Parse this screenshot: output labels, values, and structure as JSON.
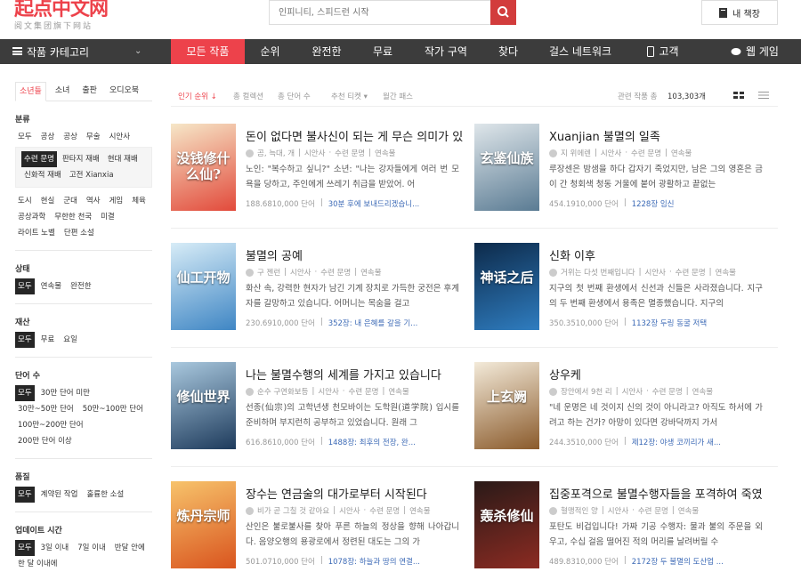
{
  "header": {
    "logo_main": "起点中文网",
    "logo_sub": "阅文集团旗下网站",
    "search_placeholder": "인피니티, 스피드런 시작",
    "shelf_label": "내 책장"
  },
  "nav": {
    "category_label": "작품 카테고리",
    "items": [
      {
        "label": "모든 작품",
        "active": true
      },
      {
        "label": "순위"
      },
      {
        "label": "완전한"
      },
      {
        "label": "무료"
      },
      {
        "label": "작가 구역"
      },
      {
        "label": "찾다"
      },
      {
        "label": "걸스 네트워크"
      },
      {
        "label": "고객"
      },
      {
        "label": "웹 게임"
      }
    ]
  },
  "sidebar": {
    "tabs": [
      "소년들",
      "소녀",
      "출판",
      "오디오북"
    ],
    "sections": {
      "genre_title": "분류",
      "genre_row1": [
        "모두",
        "공상",
        "공상",
        "무술",
        "시안사"
      ],
      "genre_sub": [
        "수련 문명",
        "판타지 재배",
        "현대 재배",
        "신화적 재배",
        "고전 Xianxia"
      ],
      "genre_more": [
        "도시",
        "현실",
        "군대",
        "역사",
        "게임",
        "체육",
        "공상과학",
        "무한한 천국",
        "미결",
        "라이트 노벨",
        "단편 소설"
      ],
      "status_title": "상태",
      "status": [
        "모두",
        "연속물",
        "완전한"
      ],
      "property_title": "재산",
      "property": [
        "모두",
        "무료",
        "요일"
      ],
      "words_title": "단어 수",
      "words": [
        "모두",
        "30만 단어 미만",
        "30만~50만 단어",
        "50만~100만 단어",
        "100만~200만 단어",
        "200만 단어 이상"
      ],
      "quality_title": "품질",
      "quality": [
        "모두",
        "계약된 작업",
        "훌륭한 소설"
      ],
      "update_title": "업데이트 시간",
      "update": [
        "모두",
        "3일 이내",
        "7일 이내",
        "반달 안에",
        "한 달 이내에"
      ]
    }
  },
  "filter": {
    "sort_active": "인기 순위 ↓",
    "sorts": [
      "총 컬렉션",
      "총 단어 수",
      "추천 티켓 ▾",
      "월간 패스"
    ],
    "total_label": "관련 작품 총",
    "total_count": "103,303개"
  },
  "books": [
    {
      "title": "돈이 없다면 불사신이 되는 게 무슨 의미가 있",
      "author": "곰, 늑대, 개",
      "tags": [
        "시안사",
        "수련 문명",
        "연속물"
      ],
      "desc": "노인: \"복수하고 싶니?\" 소년: \"나는 강자들에게 여러 번 모욕을 당하고, 주인에게 쓰레기 취급을 받았어. 어",
      "words": "188.6810,000 단어",
      "update": "30분 후에 보내드리겠습니...",
      "cover_text": "没钱修什么仙?",
      "cover_colors": [
        "#f6e7c8",
        "#e24a3b"
      ]
    },
    {
      "title": "Xuanjian 불멸의 일족",
      "author": "지 위에렌",
      "tags": [
        "시안사",
        "수련 문명",
        "연속물"
      ],
      "desc": "루장센은 밤샘을 하다 갑자기 죽었지만, 남은 그의 영혼은 금이 간 청회색 청동 거울에 붙어 광활하고 끝없는",
      "words": "454.1910,000 단어",
      "update": "1228장 임신",
      "cover_text": "玄鉴仙族",
      "cover_colors": [
        "#dfe6ea",
        "#5a7b93"
      ]
    },
    {
      "title": "불멸의 공예",
      "author": "구 젠런",
      "tags": [
        "시안사",
        "수련 문명",
        "연속물"
      ],
      "desc": "화산 속, 강력한 현자가 남긴 기계 장치로 가득한 궁전은 후계자를 갈망하고 있습니다. 어머니는 목숨을 걸고",
      "words": "230.6910,000 단어",
      "update": "352장: 내 은혜를 갚을 기...",
      "cover_text": "仙工开物",
      "cover_colors": [
        "#d7ecf7",
        "#3f86c4"
      ]
    },
    {
      "title": "신화 이후",
      "author": "거위는 다섯 번째입니다",
      "tags": [
        "시안사",
        "수련 문명",
        "연속물"
      ],
      "desc": "지구의 첫 번째 환생에서 신선과 신들은 사라졌습니다. 지구의 두 번째 환생에서 용족은 멸종했습니다. 지구의",
      "words": "350.3510,000 단어",
      "update": "1132장 두링 동굴 저택",
      "cover_text": "神话之后",
      "cover_colors": [
        "#0d2a4a",
        "#2f7dc0"
      ]
    },
    {
      "title": "나는 불멸수행의 세계를 가지고 있습니다",
      "author": "순수 구연화보등",
      "tags": [
        "시안사",
        "수련 문명",
        "연속물"
      ],
      "desc": "선종(仙宗)의 고학년생 천모바이는 도학원(道学院) 입시를 준비하며 부지런히 공부하고 있었습니다. 원래 그",
      "words": "616.8610,000 단어",
      "update": "1488장: 최후의 전장, 완...",
      "cover_text": "修仙世界",
      "cover_colors": [
        "#a9c8de",
        "#1e3b5c"
      ]
    },
    {
      "title": "상우케",
      "author": "장안에서 9천 리",
      "tags": [
        "시안사",
        "수련 문명",
        "연속물"
      ],
      "desc": "\"네 운명은 네 것이지 신의 것이 아니라고? 아직도 하서에 가려고 하는 건가? 아망이 있다면 강바닥까지 가서",
      "words": "244.3510,000 단어",
      "update": "제12장: 야생 코끼리가 새...",
      "cover_text": "上玄阙",
      "cover_colors": [
        "#f3ead9",
        "#8a5a2b"
      ]
    },
    {
      "title": "장수는 연금술의 대가로부터 시작된다",
      "author": "비가 곧 그칠 것 같아요",
      "tags": [
        "시안사",
        "수련 문명",
        "연속물"
      ],
      "desc": "산인은 불로불사를 찾아 푸른 하늘의 정상을 향해 나아갑니다. 음양오행의 용광로에서 정련된 대도는 그의 가",
      "words": "501.0710,000 단어",
      "update": "1078장: 하늘과 땅의 연결...",
      "cover_text": "炼丹宗师",
      "cover_colors": [
        "#f7c36b",
        "#d9541e"
      ]
    },
    {
      "title": "집중포격으로 불멸수행자들을 포격하여 죽였",
      "author": "혈맹적인 양",
      "tags": [
        "시안사",
        "수련 문명",
        "연속물"
      ],
      "desc": "포탄도 비겁입니다! 가짜 기공 수행자: 물과 불의 주문을 외우고, 수십 걸음 떨어진 적의 머리를 날려버릴 수",
      "words": "489.8310,000 단어",
      "update": "2172장 두 불멸의 도산업 ...",
      "cover_text": "轰杀修仙",
      "cover_colors": [
        "#2a1a18",
        "#8c2b22"
      ]
    }
  ],
  "icons": {
    "search": "search-icon",
    "shelf": "bookshelf-icon",
    "menu": "menu-icon",
    "phone": "phone-icon",
    "game": "gamepad-icon"
  },
  "colors": {
    "accent": "#ed424b",
    "nav_bg": "#3c3c3c",
    "link": "#3c6ab6"
  }
}
